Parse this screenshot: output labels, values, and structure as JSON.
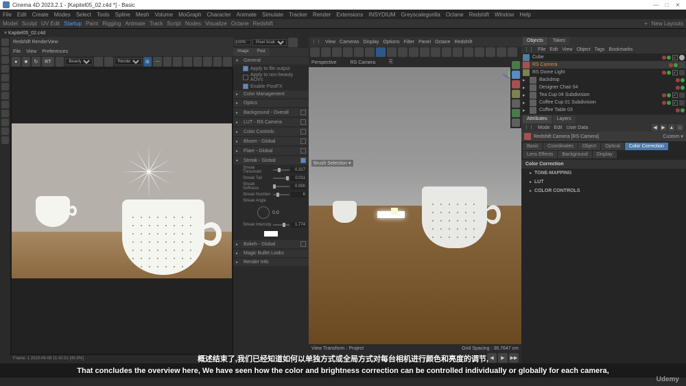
{
  "titlebar": {
    "app": "Cinema 4D 2023.2.1",
    "doc": "[Kapitel05_02.c4d *] - Basic"
  },
  "menubar": {
    "items": [
      "File",
      "Edit",
      "Create",
      "Modes",
      "Select",
      "Tools",
      "Spline",
      "Mesh",
      "Volume",
      "MoGraph",
      "Character",
      "Animate",
      "Simulate",
      "Tracker",
      "Render",
      "Extensions",
      "INSYDIUM",
      "Greyscalegorilla",
      "Octane",
      "Redshift",
      "Window",
      "Help"
    ]
  },
  "topmenu": {
    "items": [
      "Model",
      "Sculpt",
      "UV Edit",
      "Startup",
      "Paint",
      "Rigging",
      "Animate",
      "Track",
      "Script",
      "Nodes",
      "Visualize",
      "Octane",
      "Redshift"
    ],
    "active": "Startup",
    "right": [
      "+",
      "New Layouts"
    ]
  },
  "tabbar": {
    "tabs": [
      "Kapitel05_02.c4d"
    ]
  },
  "render": {
    "title": "Redshift RenderView",
    "menu": [
      "File",
      "View",
      "Preferences"
    ],
    "frame_info": "Frame: 1   2023-06-08   11:42:51   [45.9%]"
  },
  "props": {
    "tabs": [
      "Image",
      "Post"
    ],
    "general": {
      "title": "General",
      "items": [
        "Apply to file output",
        "Apply to non-beauty AOVs",
        "Enable PostFX"
      ]
    },
    "sections": [
      "Color Management",
      "Optics",
      "Background - Overall",
      "LUT - RS Camera",
      "Color Controls",
      "Bloom - Global",
      "Flare - Global",
      "Streak - Global"
    ],
    "streak": {
      "threshold": {
        "label": "Streak Threshold",
        "value": "0.317"
      },
      "tail": {
        "label": "Streak Tail",
        "value": "0.011"
      },
      "softness": {
        "label": "Streak Softness",
        "value": "0.000"
      },
      "number": {
        "label": "Streak Number",
        "value": "6"
      },
      "angle": {
        "label": "Streak Angle"
      },
      "intensity": {
        "label": "Streak Intensity",
        "value": "1.774"
      }
    },
    "bokeh": "Bokeh - Global",
    "magic_bullet": "Magic Bullet Looks",
    "render_info": "Render Info"
  },
  "viewport": {
    "menu": [
      "View",
      "Cameras",
      "Display",
      "Options",
      "Filter",
      "Panel",
      "Octane",
      "Redshift"
    ],
    "perspective": "Perspective",
    "camera": "RS Camera",
    "selection": "Brush Selection",
    "transform": "View Transform : Project",
    "grid": "Grid Spacing : 36.7647 cm"
  },
  "objects": {
    "tabs": [
      "Objects",
      "Takes"
    ],
    "menu": [
      "File",
      "Edit",
      "View",
      "Object",
      "Tags",
      "Bookmarks"
    ],
    "items": [
      {
        "name": "Cube",
        "type": "cube"
      },
      {
        "name": "RS Camera",
        "type": "cam",
        "active": true
      },
      {
        "name": "RS Dome Light",
        "type": "light"
      },
      {
        "name": "Backdrop",
        "type": "null"
      },
      {
        "name": "Designer Chair 04",
        "type": "null"
      },
      {
        "name": "Tea Cup 04 Subdivision",
        "type": "null"
      },
      {
        "name": "Coffee Cup 01 Subdivision",
        "type": "null"
      },
      {
        "name": "Coffee Table 03",
        "type": "null"
      }
    ]
  },
  "attributes": {
    "tabs_top": [
      "Attributes",
      "Layers"
    ],
    "menu": [
      "Mode",
      "Edit",
      "User Data"
    ],
    "object": "Redshift Camera [RS Camera]",
    "custom": "Custom",
    "tabs": [
      "Basic",
      "Coordinates",
      "Object",
      "Optical",
      "Color Correction",
      "Lens Effects",
      "Background",
      "Display"
    ],
    "active_tab": "Color Correction",
    "section_title": "Color Correction",
    "sections": [
      "TONE-MAPPING",
      "LUT",
      "COLOR CONTROLS"
    ]
  },
  "subtitles": {
    "cn": "概述结束了,我们已经知道如何以单独方式或全局方式对每台相机进行颜色和亮度的调节,",
    "en": "That concludes the overview here, We have seen how the color and brightness correction can be controlled individually or globally for each camera,"
  },
  "udemy": "Udemy"
}
